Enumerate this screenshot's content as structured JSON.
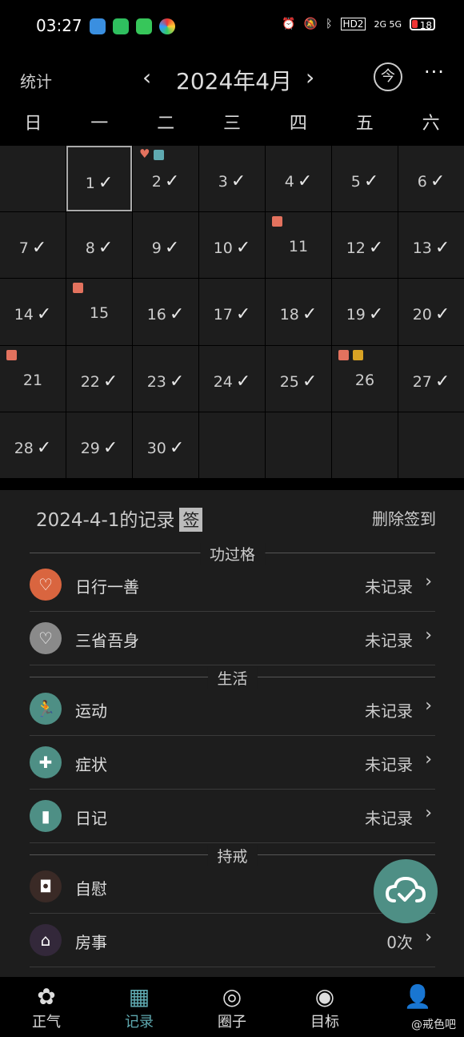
{
  "status_bar": {
    "time": "03:27",
    "network": "HD2",
    "signal": "2G 5G",
    "battery": "18"
  },
  "header": {
    "stats_label": "统计",
    "month": "2024年4月",
    "prev": "‹",
    "next": "›",
    "today_label": "今",
    "more": "···"
  },
  "weekdays": [
    "日",
    "一",
    "二",
    "三",
    "四",
    "五",
    "六"
  ],
  "calendar": {
    "selected_day": 1,
    "days": [
      {
        "d": "",
        "c": false
      },
      {
        "d": "1",
        "c": true
      },
      {
        "d": "2",
        "c": true
      },
      {
        "d": "3",
        "c": true
      },
      {
        "d": "4",
        "c": true
      },
      {
        "d": "5",
        "c": true
      },
      {
        "d": "6",
        "c": true
      },
      {
        "d": "7",
        "c": true
      },
      {
        "d": "8",
        "c": true
      },
      {
        "d": "9",
        "c": true
      },
      {
        "d": "10",
        "c": true
      },
      {
        "d": "11",
        "c": false
      },
      {
        "d": "12",
        "c": true
      },
      {
        "d": "13",
        "c": true
      },
      {
        "d": "14",
        "c": true
      },
      {
        "d": "15",
        "c": false
      },
      {
        "d": "16",
        "c": true
      },
      {
        "d": "17",
        "c": true
      },
      {
        "d": "18",
        "c": true
      },
      {
        "d": "19",
        "c": true
      },
      {
        "d": "20",
        "c": true
      },
      {
        "d": "21",
        "c": false
      },
      {
        "d": "22",
        "c": true
      },
      {
        "d": "23",
        "c": true
      },
      {
        "d": "24",
        "c": true
      },
      {
        "d": "25",
        "c": true
      },
      {
        "d": "26",
        "c": false
      },
      {
        "d": "27",
        "c": true
      },
      {
        "d": "28",
        "c": true
      },
      {
        "d": "29",
        "c": true
      },
      {
        "d": "30",
        "c": true
      },
      {
        "d": "",
        "c": false
      },
      {
        "d": "",
        "c": false
      },
      {
        "d": "",
        "c": false
      },
      {
        "d": "",
        "c": false
      }
    ],
    "markers": {
      "2": [
        "heart-icon",
        "book-icon"
      ],
      "11": [
        "toilet-paper-icon"
      ],
      "15": [
        "toilet-paper-icon"
      ],
      "21": [
        "toilet-paper-icon"
      ],
      "26": [
        "toilet-paper-icon",
        "computer-icon"
      ]
    }
  },
  "record": {
    "title": "2024-4-1的记录",
    "sign_tag": "签",
    "delete_label": "删除签到"
  },
  "sections": [
    {
      "title": "功过格",
      "items": [
        {
          "label": "日行一善",
          "value": "未记录",
          "icon": "heart-icon",
          "color": "#d9653f"
        },
        {
          "label": "三省吾身",
          "value": "未记录",
          "icon": "broken-heart-icon",
          "color": "#8a8a8a"
        }
      ]
    },
    {
      "title": "生活",
      "items": [
        {
          "label": "运动",
          "value": "未记录",
          "icon": "run-icon",
          "color": "#4e8f85"
        },
        {
          "label": "症状",
          "value": "未记录",
          "icon": "medkit-icon",
          "color": "#4e8f85"
        },
        {
          "label": "日记",
          "value": "未记录",
          "icon": "diary-icon",
          "color": "#4e8f85"
        }
      ]
    },
    {
      "title": "持戒",
      "items": [
        {
          "label": "自慰",
          "value": "",
          "icon": "toilet-paper-icon",
          "color": "#3a2a26"
        },
        {
          "label": "房事",
          "value": "0次",
          "icon": "house-icon",
          "color": "#33283a"
        }
      ]
    }
  ],
  "bottom_nav": [
    {
      "label": "正气",
      "icon": "lotus-icon",
      "active": false
    },
    {
      "label": "记录",
      "icon": "calendar-icon",
      "active": true
    },
    {
      "label": "圈子",
      "icon": "circle-icon",
      "active": false
    },
    {
      "label": "目标",
      "icon": "target-icon",
      "active": false
    },
    {
      "label": "",
      "icon": "user-icon",
      "active": false
    }
  ],
  "watermark": "@戒色吧",
  "colors": {
    "accent": "#5fa9b0",
    "fab": "#4e8f85",
    "marker_red": "#e3725e",
    "marker_yellow": "#d9a324"
  }
}
